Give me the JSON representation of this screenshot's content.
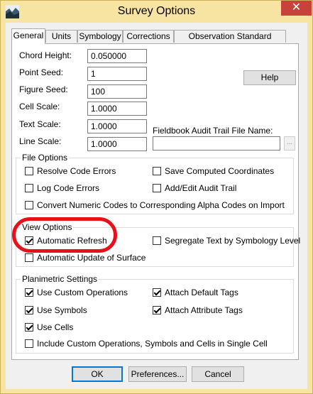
{
  "window": {
    "title": "Survey Options"
  },
  "titlebar": {
    "close_glyph": "✕",
    "app_icon": "app-icon"
  },
  "tabs": [
    {
      "label": "General",
      "active": true
    },
    {
      "label": "Units"
    },
    {
      "label": "Symbology"
    },
    {
      "label": "Corrections"
    },
    {
      "label": "Observation Standard Deviation"
    }
  ],
  "general": {
    "chord_height_label": "Chord Height:",
    "chord_height_value": "0.050000",
    "point_seed_label": "Point Seed:",
    "point_seed_value": "1",
    "figure_seed_label": "Figure Seed:",
    "figure_seed_value": "100",
    "cell_scale_label": "Cell Scale:",
    "cell_scale_value": "1.0000",
    "text_scale_label": "Text Scale:",
    "text_scale_value": "1.0000",
    "line_scale_label": "Line Scale:",
    "line_scale_value": "1.0000",
    "help_label": "Help",
    "audit_label": "Fieldbook Audit Trail File Name:",
    "audit_value": "",
    "browse_label": "..."
  },
  "file_options": {
    "title": "File Options",
    "resolve_code_errors": {
      "label": "Resolve Code Errors",
      "checked": false
    },
    "save_computed_coordinates": {
      "label": "Save Computed Coordinates",
      "checked": false
    },
    "log_code_errors": {
      "label": "Log Code Errors",
      "checked": false
    },
    "add_edit_audit_trail": {
      "label": "Add/Edit Audit Trail",
      "checked": false
    },
    "convert_numeric_codes": {
      "label": "Convert Numeric Codes to Corresponding Alpha Codes on Import",
      "checked": false
    }
  },
  "view_options": {
    "title": "View Options",
    "automatic_refresh": {
      "label": "Automatic Refresh",
      "checked": true
    },
    "segregate_text": {
      "label": "Segregate Text by Symbology Level",
      "checked": false
    },
    "automatic_update_surface": {
      "label": "Automatic Update of Surface",
      "checked": false
    }
  },
  "planimetric_settings": {
    "title": "Planimetric Settings",
    "use_custom_operations": {
      "label": "Use Custom Operations",
      "checked": true
    },
    "attach_default_tags": {
      "label": "Attach Default Tags",
      "checked": true
    },
    "use_symbols": {
      "label": "Use Symbols",
      "checked": true
    },
    "attach_attribute_tags": {
      "label": "Attach Attribute Tags",
      "checked": true
    },
    "use_cells": {
      "label": "Use Cells",
      "checked": true
    },
    "include_in_single_cell": {
      "label": "Include Custom Operations, Symbols and Cells in Single Cell",
      "checked": false
    }
  },
  "footer": {
    "ok_label": "OK",
    "preferences_label": "Preferences...",
    "cancel_label": "Cancel"
  },
  "colors": {
    "title_bar": "#f7e3a2",
    "close_button": "#c7423a",
    "annotation_circle": "#e8111a"
  }
}
